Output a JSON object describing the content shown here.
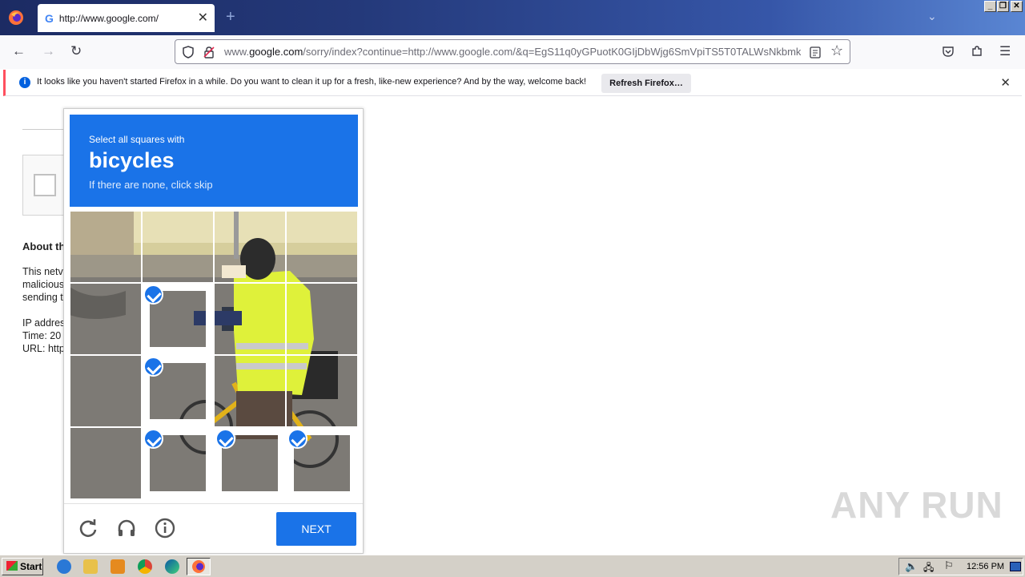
{
  "browser": {
    "tab_title": "http://www.google.com/",
    "url_prefix": "www.",
    "url_domain": "google.com",
    "url_rest": "/sorry/index?continue=http://www.google.com/&q=EgS11q0yGPuotK0GIjDbWjg6SmVpiTS5T0TALWsNkbmkX",
    "notification": "It looks like you haven't started Firefox in a while. Do you want to clean it up for a fresh, like-new experience? And by the way, welcome back!",
    "refresh_label": "Refresh Firefox…"
  },
  "page": {
    "about": "About th",
    "line1": "This netv",
    "line2": "malicious",
    "line3": "sending t",
    "ip": "IP addres",
    "time": "Time: 20",
    "url": "URL: http"
  },
  "challenge": {
    "instruction": "Select all squares with",
    "target": "bicycles",
    "hint": "If there are none, click skip",
    "next_label": "NEXT",
    "selected_tiles": [
      5,
      9,
      13,
      14,
      15
    ],
    "accent": "#1a73e8"
  },
  "icons": {
    "reload": "reload-icon",
    "audio": "headphones-icon",
    "info": "info-icon"
  },
  "watermark": "ANY RUN",
  "taskbar": {
    "start_label": "Start",
    "clock": "12:56 PM"
  }
}
